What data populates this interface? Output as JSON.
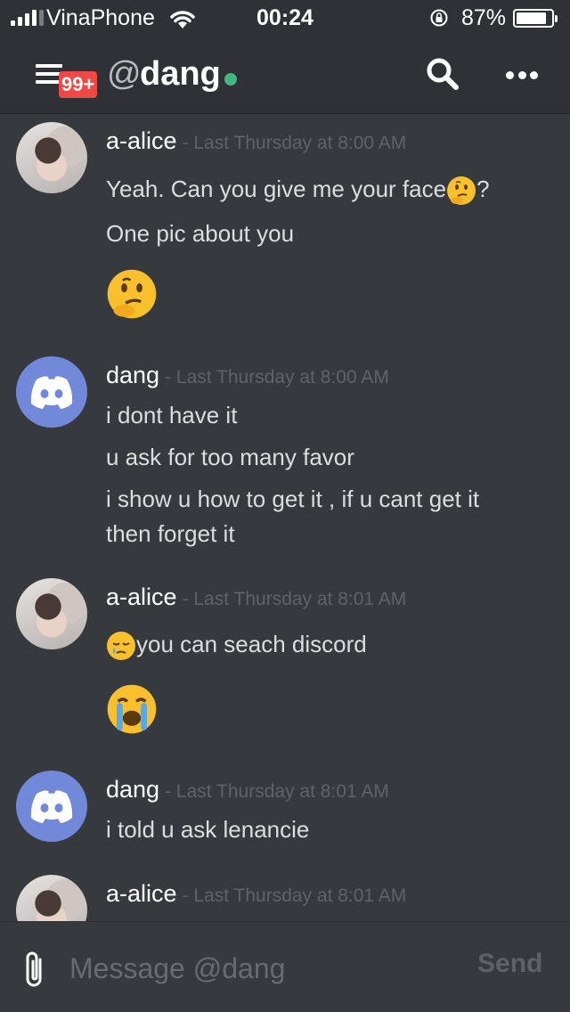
{
  "status_bar": {
    "carrier": "VinaPhone",
    "time": "00:24",
    "battery_percent": "87%",
    "battery_level": 0.87,
    "signal_bars": 4
  },
  "header": {
    "menu_icon": "hamburger-menu-icon",
    "badge": "99+",
    "channel_prefix": "@",
    "channel_name": "dang",
    "status": "online",
    "status_color": "#43b581",
    "search_icon": "search-icon",
    "more_icon": "more-icon"
  },
  "messages": [
    {
      "author": "a-alice",
      "timestamp": "- Last Thursday at 8:00 AM",
      "avatar": "user-photo",
      "lines": [
        {
          "text": "Yeah. Can you give me your face",
          "suffix": "?",
          "emoji_after": "thinking-face"
        },
        {
          "text": "One pic about you"
        }
      ],
      "big_emoji": "thinking-face"
    },
    {
      "author": "dang",
      "timestamp": "- Last Thursday at 8:00 AM",
      "avatar": "discord-logo",
      "lines": [
        {
          "text": "i dont have it"
        },
        {
          "text": "u ask for too many favor"
        },
        {
          "text": "i show u how to get it , if u cant get it then forget it"
        }
      ]
    },
    {
      "author": "a-alice",
      "timestamp": "- Last Thursday at 8:01 AM",
      "avatar": "user-photo",
      "lines": [
        {
          "text": "you can seach discord",
          "emoji_before": "sleepy-face"
        }
      ],
      "big_emoji": "loudly-crying-face"
    },
    {
      "author": "dang",
      "timestamp": "- Last Thursday at 8:01 AM",
      "avatar": "discord-logo",
      "lines": [
        {
          "text": "i told u ask lenancie"
        }
      ]
    },
    {
      "author": "a-alice",
      "timestamp": "- Last Thursday at 8:01 AM",
      "avatar": "user-photo",
      "lines": []
    }
  ],
  "composer": {
    "attach_icon": "paperclip-icon",
    "placeholder": "Message @dang",
    "send_label": "Send"
  },
  "colors": {
    "background": "#36393e",
    "header": "#2f3136",
    "badge": "#f04747",
    "discord_blurple": "#7289da",
    "timestamp": "#5f6268"
  }
}
